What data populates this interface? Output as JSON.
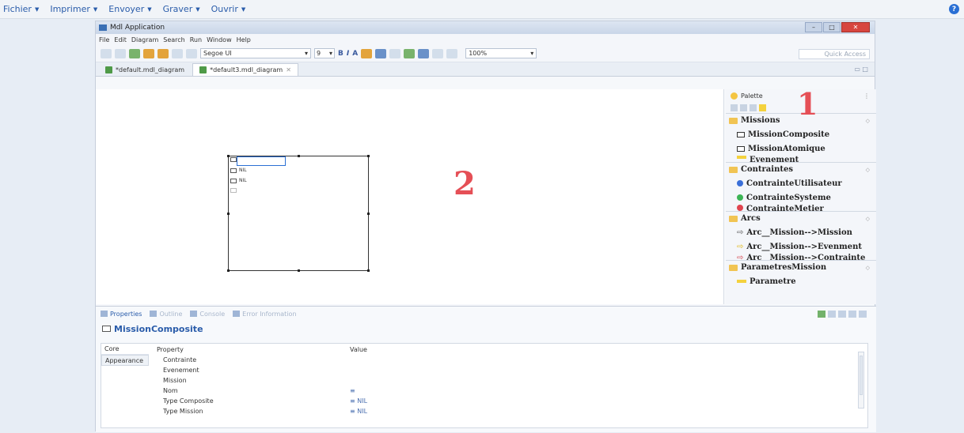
{
  "outer_menu": [
    {
      "label": "Fichier"
    },
    {
      "label": "Imprimer"
    },
    {
      "label": "Envoyer"
    },
    {
      "label": "Graver"
    },
    {
      "label": "Ouvrir"
    }
  ],
  "window": {
    "title": "Mdl Application"
  },
  "menubar": [
    "File",
    "Edit",
    "Diagram",
    "Search",
    "Run",
    "Window",
    "Help"
  ],
  "toolbar": {
    "font": "Segoe UI",
    "font_size": "9",
    "bold": "B",
    "italic": "I",
    "font_color": "A",
    "zoom": "100%",
    "quick_access": "Quick Access"
  },
  "editor_tabs": [
    {
      "label": "*default.mdl_diagram"
    },
    {
      "label": "*default3.mdl_diagram"
    }
  ],
  "canvas": {
    "node_rows": [
      "NIL",
      "NIL"
    ],
    "annotation": "2"
  },
  "palette": {
    "title": "Palette",
    "annotation": "1",
    "drawers": [
      {
        "title": "Missions",
        "entries": [
          "MissionComposite",
          "MissionAtomique",
          "Evenement"
        ]
      },
      {
        "title": "Contraintes",
        "entries": [
          "ContrainteUtilisateur",
          "ContrainteSysteme",
          "ContrainteMetier"
        ]
      },
      {
        "title": "Arcs",
        "entries": [
          "Arc__Mission-->Mission",
          "Arc__Mission-->Evenment",
          "Arc__Mission-->Contrainte"
        ]
      },
      {
        "title": "ParametresMission",
        "entries": [
          "Parametre"
        ]
      }
    ],
    "colors": {
      "utilisateur": "#3a6fd8",
      "systeme": "#3cb455",
      "metier": "#e0454f"
    }
  },
  "properties": {
    "tabs": [
      {
        "label": "Properties"
      },
      {
        "label": "Outline"
      },
      {
        "label": "Console"
      },
      {
        "label": "Error Information"
      }
    ],
    "selection": "MissionComposite",
    "side_tabs": [
      "Core",
      "Appearance"
    ],
    "columns": {
      "property": "Property",
      "value": "Value"
    },
    "rows": [
      {
        "property": "Contrainte",
        "value": ""
      },
      {
        "property": "Evenement",
        "value": ""
      },
      {
        "property": "Mission",
        "value": ""
      },
      {
        "property": "Nom",
        "value": "≡"
      },
      {
        "property": "Type Composite",
        "value": "≡ NIL"
      },
      {
        "property": "Type Mission",
        "value": "≡ NIL"
      }
    ]
  }
}
